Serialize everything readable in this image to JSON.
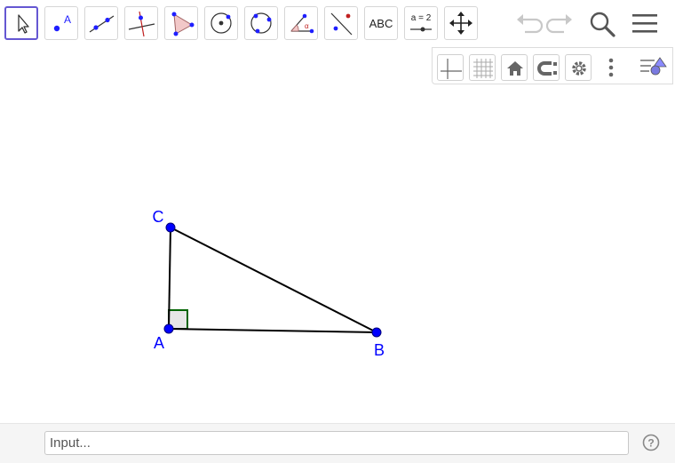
{
  "toolbar": {
    "tools": [
      {
        "name": "move-tool-icon"
      },
      {
        "name": "point-tool-icon",
        "label": "A"
      },
      {
        "name": "line-tool-icon"
      },
      {
        "name": "perpendicular-tool-icon"
      },
      {
        "name": "polygon-tool-icon"
      },
      {
        "name": "circle-center-point-tool-icon"
      },
      {
        "name": "circle-three-points-tool-icon"
      },
      {
        "name": "angle-tool-icon"
      },
      {
        "name": "reflect-tool-icon"
      },
      {
        "name": "text-tool-icon",
        "label": "ABC"
      },
      {
        "name": "slider-tool-icon",
        "label": "a = 2"
      },
      {
        "name": "move-view-tool-icon"
      }
    ],
    "right": [
      "undo-icon",
      "redo-icon",
      "search-icon",
      "menu-icon"
    ]
  },
  "style_bar": {
    "buttons": [
      "axes-icon",
      "grid-icon",
      "home-icon",
      "point-capturing-icon",
      "settings-icon",
      "more-icon",
      "toggle-style-bar-icon"
    ]
  },
  "graphics": {
    "points": [
      {
        "label": "A",
        "x": 0,
        "y": 0
      },
      {
        "label": "B",
        "x": 5,
        "y": 0
      },
      {
        "label": "C",
        "x": 0,
        "y": 2.5
      }
    ],
    "segments": [
      [
        "A",
        "B"
      ],
      [
        "B",
        "C"
      ],
      [
        "C",
        "A"
      ]
    ],
    "right_angle_at": "A",
    "colors": {
      "point": "#0000ff",
      "label": "#0000ff",
      "segment": "#000000",
      "angle": "#006400",
      "angle_fill": "#e6e6e6"
    }
  },
  "input_bar": {
    "placeholder": "Input..."
  },
  "colors": {
    "selected_tool_border": "#6557d2"
  }
}
